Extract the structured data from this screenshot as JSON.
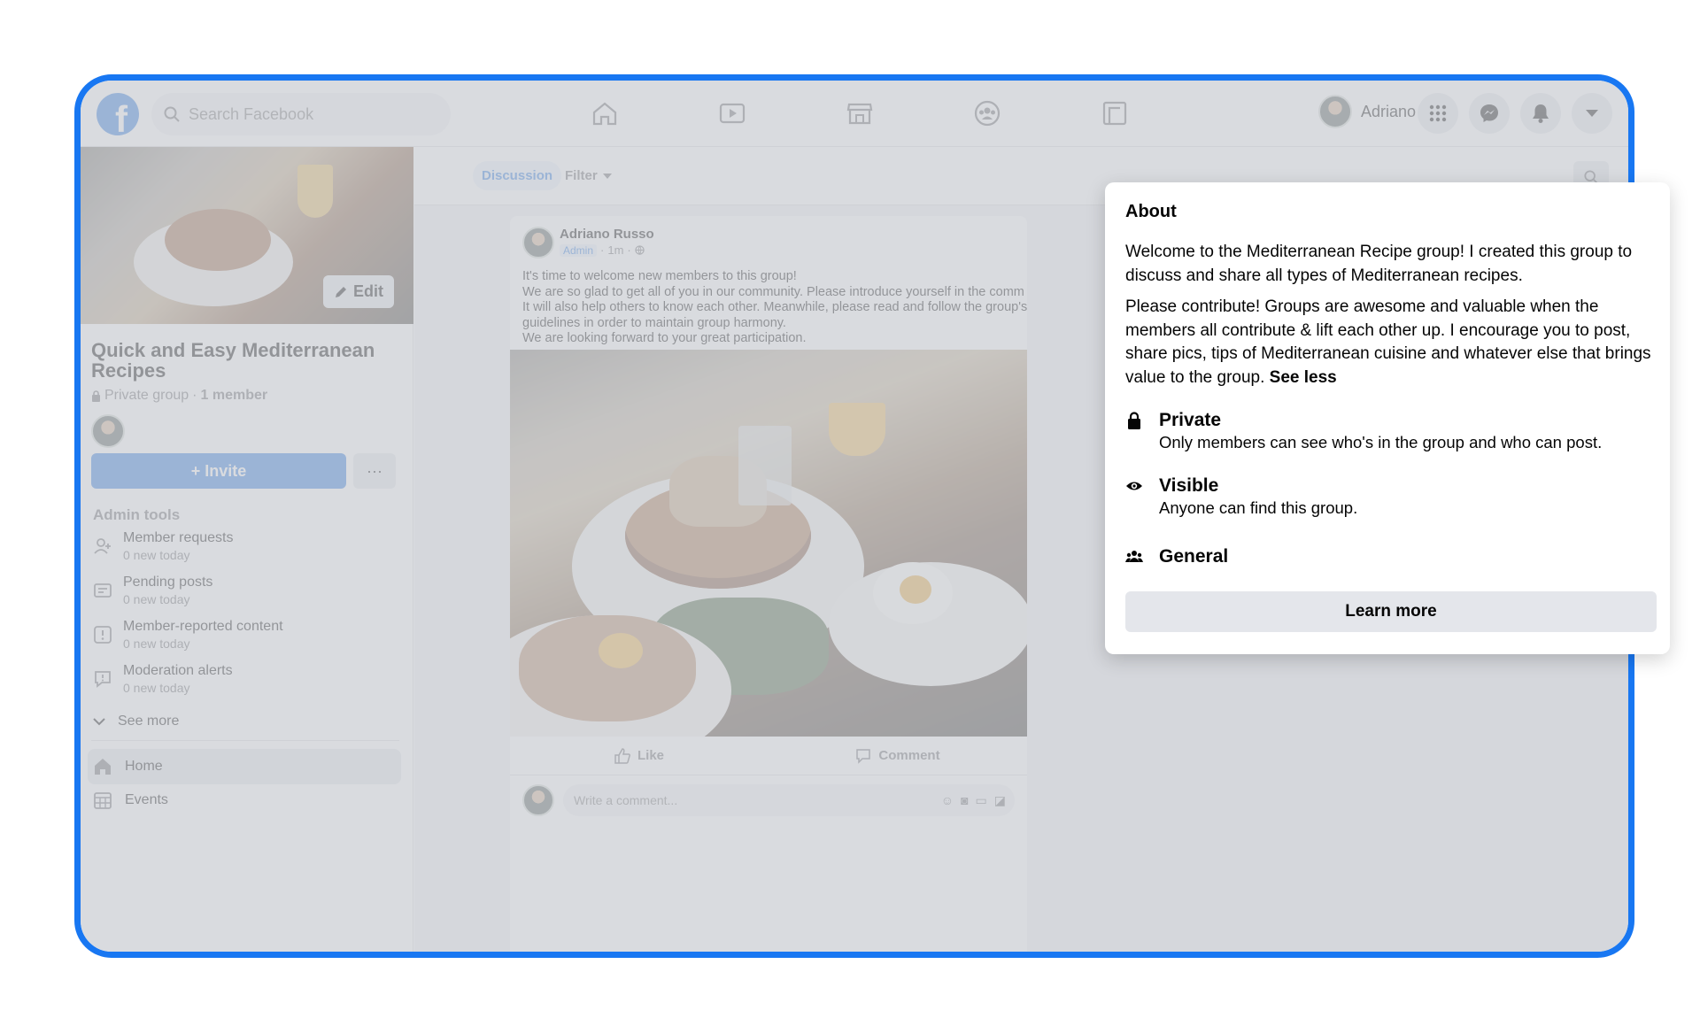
{
  "topbar": {
    "logo": "f",
    "search_placeholder": "Search Facebook",
    "account_name": "Adriano",
    "nav_icons": [
      "home-icon",
      "watch-icon",
      "marketplace-icon",
      "groups-icon",
      "gaming-icon"
    ],
    "accent_color": "#1877f2"
  },
  "sidebar": {
    "edit_label": "Edit",
    "group_name": "Quick and Easy Mediterranean Recipes",
    "privacy": "Private group",
    "member_count": "1 member",
    "invite_label": "+ Invite",
    "more_label": "···",
    "admin_tools_title": "Admin tools",
    "admin_tools": [
      {
        "label": "Member requests",
        "status": "0 new today"
      },
      {
        "label": "Pending posts",
        "status": "0 new today"
      },
      {
        "label": "Member-reported content",
        "status": "0 new today"
      },
      {
        "label": "Moderation alerts",
        "status": "0 new today"
      }
    ],
    "see_more": "See more",
    "nav": [
      {
        "label": "Home"
      },
      {
        "label": "Events"
      }
    ]
  },
  "main": {
    "tabs": {
      "discussion": "Discussion",
      "filter": "Filter"
    },
    "post": {
      "author": "Adriano Russo",
      "role": "Admin",
      "time": "1m",
      "lines": [
        "It's time to welcome new members to this group!",
        "We are so glad to get all of you in our community. Please introduce yourself in the comm",
        "It will also help others to know each other. Meanwhile, please read and follow the group's",
        "guidelines in order to maintain group harmony.",
        "We are looking forward to your great participation."
      ],
      "like_label": "Like",
      "comment_label": "Comment",
      "comment_placeholder": "Write a comment..."
    }
  },
  "about": {
    "title": "About",
    "paragraph1": "Welcome to the Mediterranean Recipe group! I created this group to discuss and share all types of Mediterranean recipes.",
    "paragraph2": "Please contribute! Groups are awesome and valuable when the members all contribute & lift each other up. I encourage you to post, share pics, tips of Mediterranean cuisine and whatever else that brings value to the group.",
    "see_less": "See less",
    "private_title": "Private",
    "private_desc": "Only members can see who's in the group and who can post.",
    "visible_title": "Visible",
    "visible_desc": "Anyone can find this group.",
    "general_title": "General",
    "learn_more": "Learn more"
  }
}
